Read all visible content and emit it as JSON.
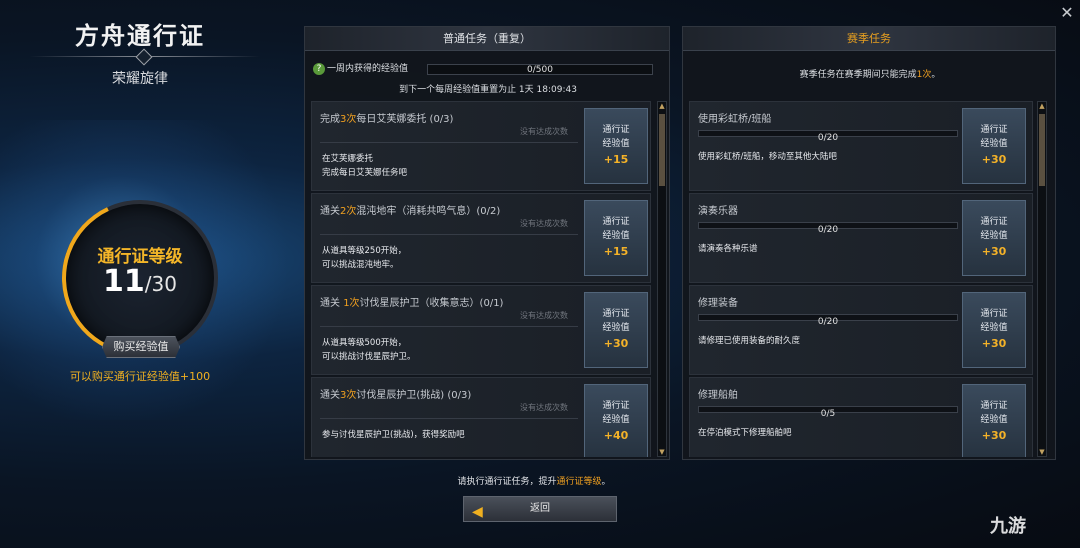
{
  "left": {
    "title": "方舟通行证",
    "subtitle": "荣耀旋律",
    "level_label": "通行证等级",
    "level_current": "11",
    "level_total": "/30",
    "buy_button": "购买经验值",
    "buy_note": "可以购买通行证经验值+100"
  },
  "normal": {
    "header": "普通任务（重复）",
    "weekly_label": "一周内获得的经验值",
    "weekly_value": "0/500",
    "reset_text": "到下一个每周经验值重置为止 1天 18:09:43",
    "tasks": [
      {
        "title_pre": "完成",
        "title_hl": "3次",
        "title_post": "每日艾芙娜委托 (0/3)",
        "state": "没有达成次数",
        "desc1": "在艾芙娜委托",
        "desc2": "完成每日艾芙娜任务吧",
        "reward_l1": "通行证",
        "reward_l2": "经验值",
        "reward_pts": "+15"
      },
      {
        "title_pre": "通关",
        "title_hl": "2次",
        "title_post": "混沌地牢（消耗共鸣气息）(0/2)",
        "state": "没有达成次数",
        "desc1": "从道具等级250开始，",
        "desc2": "可以挑战混沌地牢。",
        "reward_l1": "通行证",
        "reward_l2": "经验值",
        "reward_pts": "+15"
      },
      {
        "title_pre": "通关 ",
        "title_hl": "1次",
        "title_post": "讨伐星辰护卫（收集意志）(0/1)",
        "state": "没有达成次数",
        "desc1": "从道具等级500开始，",
        "desc2": "可以挑战讨伐星辰护卫。",
        "reward_l1": "通行证",
        "reward_l2": "经验值",
        "reward_pts": "+30"
      },
      {
        "title_pre": "通关",
        "title_hl": "3次",
        "title_post": "讨伐星辰护卫(挑战) (0/3)",
        "state": "没有达成次数",
        "desc1": "参与讨伐星辰护卫(挑战)，获得奖励吧",
        "desc2": "",
        "reward_l1": "通行证",
        "reward_l2": "经验值",
        "reward_pts": "+40"
      }
    ]
  },
  "season": {
    "header": "赛季任务",
    "note_pre": "赛季任务在赛季期间只能完成",
    "note_hl": "1次",
    "note_post": "。",
    "tasks": [
      {
        "title": "使用彩虹桥/班船",
        "progress": "0/20",
        "desc": "使用彩虹桥/班船，移动至其他大陆吧",
        "reward_l1": "通行证",
        "reward_l2": "经验值",
        "reward_pts": "+30"
      },
      {
        "title": "演奏乐器",
        "progress": "0/20",
        "desc": "请演奏各种乐谱",
        "reward_l1": "通行证",
        "reward_l2": "经验值",
        "reward_pts": "+30"
      },
      {
        "title": "修理装备",
        "progress": "0/20",
        "desc": "请修理已使用装备的耐久度",
        "reward_l1": "通行证",
        "reward_l2": "经验值",
        "reward_pts": "+30"
      },
      {
        "title": "修理船舶",
        "progress": "0/5",
        "desc": "在停泊模式下修理船舶吧",
        "reward_l1": "通行证",
        "reward_l2": "经验值",
        "reward_pts": "+30"
      }
    ]
  },
  "footer": {
    "note_pre": "请执行通行证任务，提升",
    "note_hl": "通行证等级",
    "note_post": "。",
    "back_button": "返回"
  },
  "watermark": "九游",
  "close_glyph": "✕"
}
